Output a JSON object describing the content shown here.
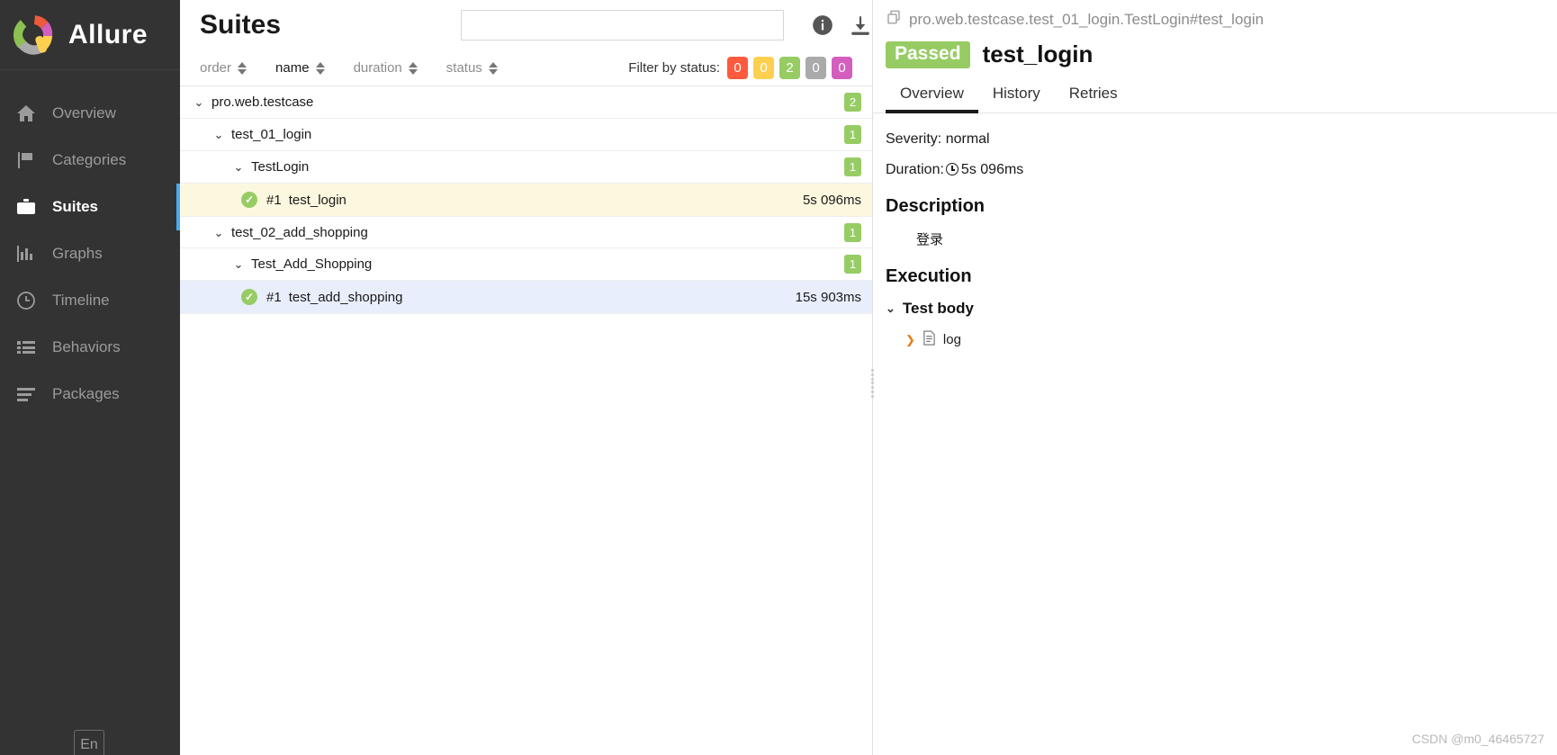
{
  "sidebar": {
    "brand": "Allure",
    "items": [
      {
        "label": "Overview",
        "icon": "home-icon",
        "active": false
      },
      {
        "label": "Categories",
        "icon": "flag-icon",
        "active": false
      },
      {
        "label": "Suites",
        "icon": "briefcase-icon",
        "active": true
      },
      {
        "label": "Graphs",
        "icon": "bar-chart-icon",
        "active": false
      },
      {
        "label": "Timeline",
        "icon": "clock-icon",
        "active": false
      },
      {
        "label": "Behaviors",
        "icon": "list-icon",
        "active": false
      },
      {
        "label": "Packages",
        "icon": "layers-icon",
        "active": false
      }
    ],
    "language_button": "En"
  },
  "middle": {
    "title": "Suites",
    "search_placeholder": "",
    "search_value": "",
    "header_icons": [
      {
        "name": "info-icon"
      },
      {
        "name": "download-icon"
      }
    ],
    "sorters": [
      "order",
      "name",
      "duration",
      "status"
    ],
    "filter_label": "Filter by status:",
    "status_badges": [
      {
        "name": "failed",
        "count": "0",
        "color": "#fd5a3e"
      },
      {
        "name": "broken",
        "count": "0",
        "color": "#ffd050"
      },
      {
        "name": "passed",
        "count": "2",
        "color": "#97cc64"
      },
      {
        "name": "skipped",
        "count": "0",
        "color": "#aaaaaa"
      },
      {
        "name": "unknown",
        "count": "0",
        "color": "#d35ebe"
      }
    ],
    "tree": [
      {
        "level": 0,
        "kind": "node",
        "chevron": "⌄",
        "name": "pro.web.testcase",
        "badge": "2",
        "state": ""
      },
      {
        "level": 1,
        "kind": "node",
        "chevron": "⌄",
        "name": "test_01_login",
        "badge": "1",
        "state": ""
      },
      {
        "level": 2,
        "kind": "node",
        "chevron": "⌄",
        "name": "TestLogin",
        "badge": "1",
        "state": ""
      },
      {
        "level": 3,
        "kind": "leaf",
        "status": "passed",
        "number": "#1",
        "name": "test_login",
        "duration": "5s 096ms",
        "state": "sel"
      },
      {
        "level": 1,
        "kind": "node",
        "chevron": "⌄",
        "name": "test_02_add_shopping",
        "badge": "1",
        "state": ""
      },
      {
        "level": 2,
        "kind": "node",
        "chevron": "⌄",
        "name": "Test_Add_Shopping",
        "badge": "1",
        "state": ""
      },
      {
        "level": 3,
        "kind": "leaf",
        "status": "passed",
        "number": "#1",
        "name": "test_add_shopping",
        "duration": "15s 903ms",
        "state": "hov"
      }
    ]
  },
  "detail": {
    "breadcrumb": "pro.web.testcase.test_01_login.TestLogin#test_login",
    "status_badge": "Passed",
    "title": "test_login",
    "tabs": [
      {
        "label": "Overview",
        "active": true
      },
      {
        "label": "History",
        "active": false
      },
      {
        "label": "Retries",
        "active": false
      }
    ],
    "severity": "Severity: normal",
    "duration_label": "Duration:",
    "duration_value": "5s 096ms",
    "description_heading": "Description",
    "description_text": "登录",
    "execution_heading": "Execution",
    "test_body_label": "Test body",
    "log_label": "log"
  },
  "watermark": "CSDN @m0_46465727"
}
